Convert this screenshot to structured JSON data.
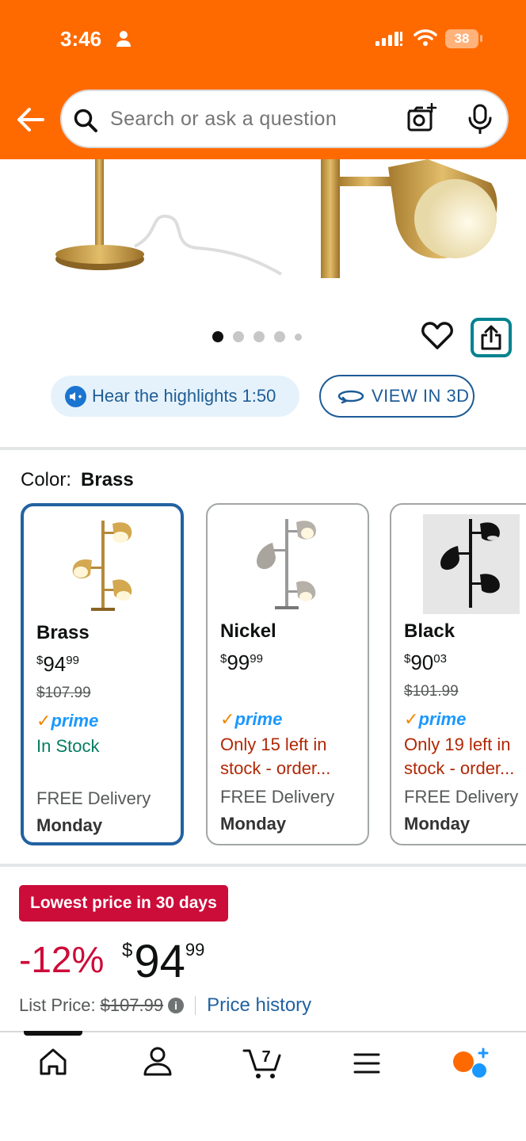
{
  "status_bar": {
    "time": "3:46",
    "battery": "38"
  },
  "search": {
    "placeholder": "Search or ask a question"
  },
  "gallery": {
    "dots": 5,
    "active_index": 0
  },
  "actions": {
    "hear_label": "Hear the highlights 1:50",
    "view3d_label": "VIEW IN 3D"
  },
  "color_selector": {
    "label": "Color:",
    "selected": "Brass",
    "options": [
      {
        "name": "Brass",
        "price_whole": "94",
        "price_cents": "99",
        "price_symbol": "$",
        "list_price": "$107.99",
        "prime": "prime",
        "stock": "In Stock",
        "delivery": "FREE Delivery",
        "day": "Monday"
      },
      {
        "name": "Nickel",
        "price_whole": "99",
        "price_cents": "99",
        "price_symbol": "$",
        "list_price": "",
        "prime": "prime",
        "stock": "Only 15 left in stock - order...",
        "delivery": "FREE Delivery",
        "day": "Monday"
      },
      {
        "name": "Black",
        "price_whole": "90",
        "price_cents": "03",
        "price_symbol": "$",
        "list_price": "$101.99",
        "prime": "prime",
        "stock": "Only 19 left in stock - order...",
        "delivery": "FREE Delivery",
        "day": "Monday"
      }
    ]
  },
  "deal": {
    "badge": "Lowest price in 30 days",
    "discount": "-12%",
    "price_symbol": "$",
    "price_whole": "94",
    "price_cents": "99",
    "list_price_label": "List Price:",
    "list_price": "$107.99",
    "price_history": "Price history"
  },
  "bottom_nav": {
    "cart_count": "7",
    "items": [
      "home-icon",
      "account-icon",
      "cart-icon",
      "menu-icon",
      "rufus-icon"
    ]
  },
  "colors": {
    "header": "#ff6a00",
    "link": "#2162a1",
    "deal_red": "#cc0c39",
    "in_stock": "#067d62",
    "low_stock": "#b12704",
    "prime_blue": "#1a98ff"
  }
}
